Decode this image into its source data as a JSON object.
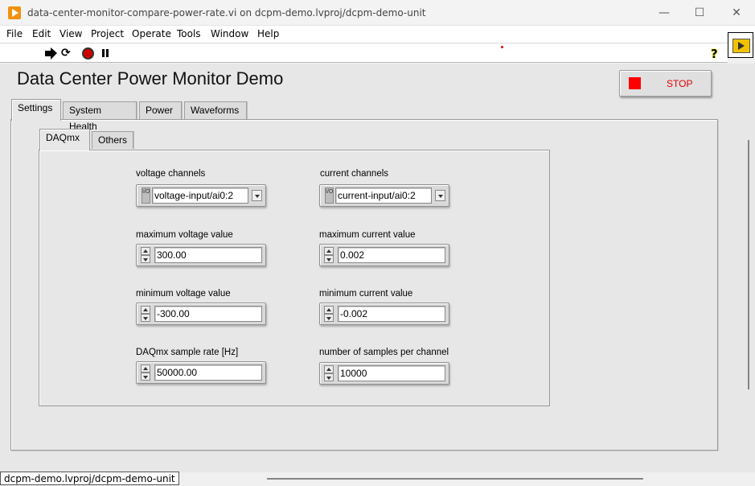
{
  "window": {
    "title": "data-center-monitor-compare-power-rate.vi on dcpm-demo.lvproj/dcpm-demo-unit",
    "minimize": "—",
    "maximize": "☐",
    "close": "✕"
  },
  "menu": [
    "File",
    "Edit",
    "View",
    "Project",
    "Operate",
    "Tools",
    "Window",
    "Help"
  ],
  "toolbar": {
    "run_continuously_glyph": "⟳",
    "help_glyph": "?"
  },
  "page": {
    "title": "Data Center Power Monitor Demo",
    "stop_label": "STOP"
  },
  "tabs": [
    "Settings",
    "System Health",
    "Power",
    "Waveforms"
  ],
  "subtabs": [
    "DAQmx",
    "Others"
  ],
  "fields": {
    "voltage_channels": {
      "label": "voltage channels",
      "value": "voltage-input/ai0:2"
    },
    "current_channels": {
      "label": "current channels",
      "value": "current-input/ai0:2"
    },
    "max_voltage": {
      "label": "maximum voltage value",
      "value": "300.00"
    },
    "max_current": {
      "label": "maximum current value",
      "value": "0.002"
    },
    "min_voltage": {
      "label": "minimum voltage value",
      "value": "-300.00"
    },
    "min_current": {
      "label": "minimum current value",
      "value": "-0.002"
    },
    "sample_rate": {
      "label": "DAQmx sample rate [Hz]",
      "value": "50000.00"
    },
    "samples_per_channel": {
      "label": "number of samples per channel",
      "value": "10000"
    }
  },
  "io_icon_text": "I/O",
  "status": {
    "path": "dcpm-demo.lvproj/dcpm-demo-unit"
  }
}
